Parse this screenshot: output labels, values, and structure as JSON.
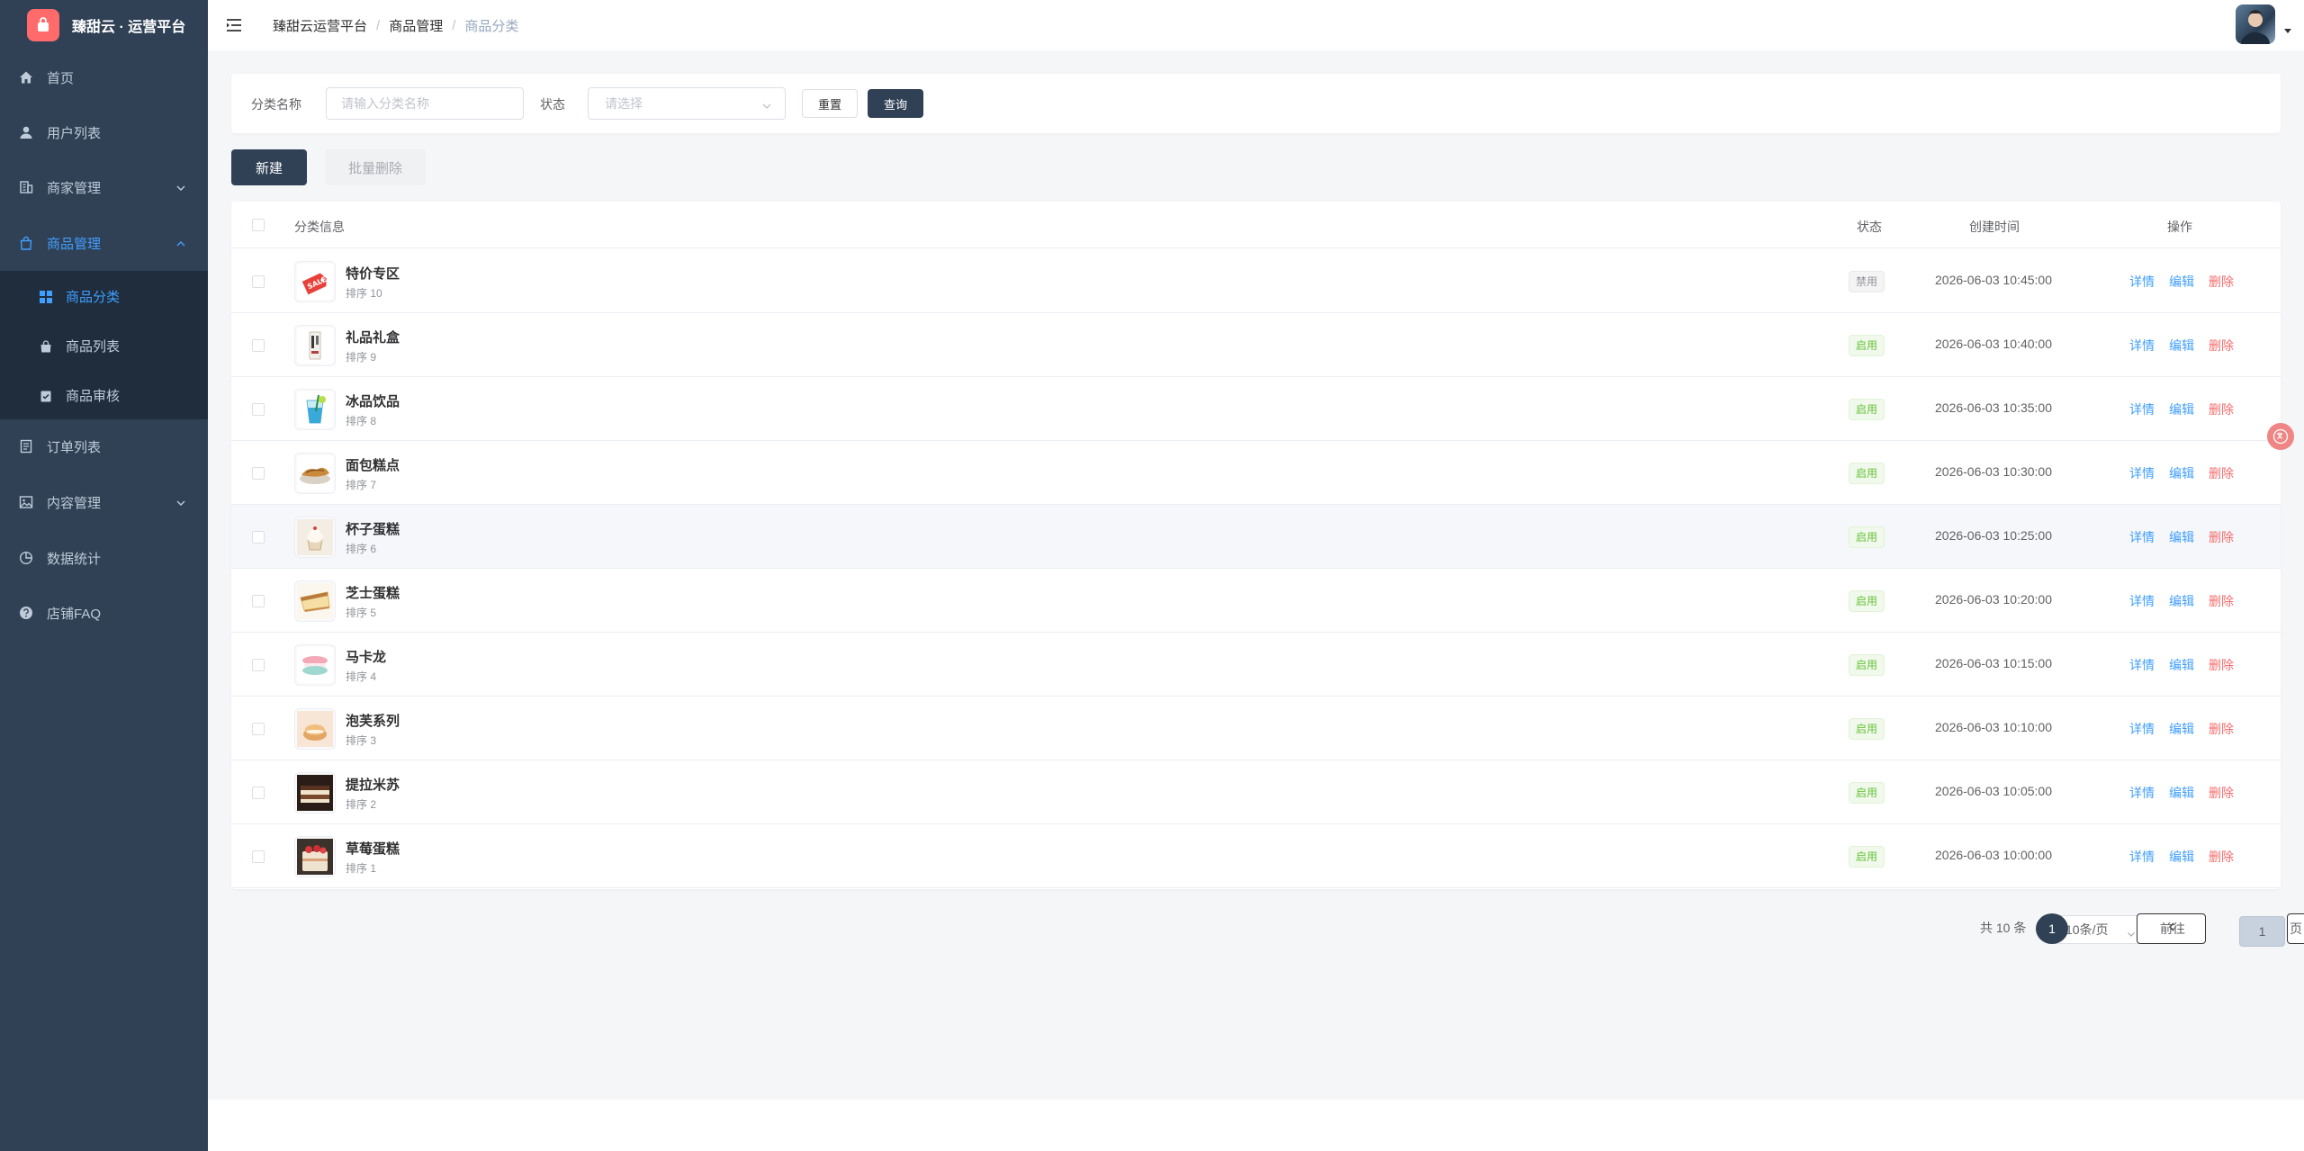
{
  "app": {
    "title": "臻甜云 · 运营平台",
    "brand_color": "#ff6b6b",
    "sidebar_bg": "#304156",
    "accent": "#409eff"
  },
  "sidebar": {
    "items": [
      {
        "label": "首页",
        "icon": "home-icon"
      },
      {
        "label": "用户列表",
        "icon": "user-icon"
      },
      {
        "label": "商家管理",
        "icon": "building-icon"
      },
      {
        "label": "商品管理",
        "icon": "shopping-bag-icon"
      },
      {
        "label": "订单列表",
        "icon": "document-icon"
      },
      {
        "label": "内容管理",
        "icon": "image-icon"
      },
      {
        "label": "数据统计",
        "icon": "pie-chart-icon"
      },
      {
        "label": "店铺FAQ",
        "icon": "help-icon"
      }
    ],
    "subitems": [
      {
        "label": "商品分类",
        "icon": "grid-icon"
      },
      {
        "label": "商品列表",
        "icon": "bag-icon"
      },
      {
        "label": "商品审核",
        "icon": "clipboard-check-icon"
      }
    ]
  },
  "header": {
    "breadcrumb": [
      "臻甜云运营平台",
      "商品管理",
      "商品分类"
    ]
  },
  "search": {
    "name_label": "分类名称",
    "name_placeholder": "请输入分类名称",
    "status_label": "状态",
    "status_placeholder": "请选择",
    "reset_label": "重置",
    "query_label": "查询"
  },
  "toolbar": {
    "new_label": "新建",
    "batch_delete_label": "批量删除"
  },
  "table": {
    "columns": {
      "info": "分类信息",
      "status": "状态",
      "created": "创建时间",
      "actions": "操作"
    },
    "actions": {
      "detail": "详情",
      "edit": "编辑",
      "delete": "删除"
    },
    "rows": [
      {
        "name": "特价专区",
        "sort": "排序 10",
        "status": "禁用",
        "enabled": false,
        "created": "2026-06-03 10:45:00"
      },
      {
        "name": "礼品礼盒",
        "sort": "排序 9",
        "status": "启用",
        "enabled": true,
        "created": "2026-06-03 10:40:00"
      },
      {
        "name": "冰品饮品",
        "sort": "排序 8",
        "status": "启用",
        "enabled": true,
        "created": "2026-06-03 10:35:00"
      },
      {
        "name": "面包糕点",
        "sort": "排序 7",
        "status": "启用",
        "enabled": true,
        "created": "2026-06-03 10:30:00"
      },
      {
        "name": "杯子蛋糕",
        "sort": "排序 6",
        "status": "启用",
        "enabled": true,
        "created": "2026-06-03 10:25:00"
      },
      {
        "name": "芝士蛋糕",
        "sort": "排序 5",
        "status": "启用",
        "enabled": true,
        "created": "2026-06-03 10:20:00"
      },
      {
        "name": "马卡龙",
        "sort": "排序 4",
        "status": "启用",
        "enabled": true,
        "created": "2026-06-03 10:15:00"
      },
      {
        "name": "泡芙系列",
        "sort": "排序 3",
        "status": "启用",
        "enabled": true,
        "created": "2026-06-03 10:10:00"
      },
      {
        "name": "提拉米苏",
        "sort": "排序 2",
        "status": "启用",
        "enabled": true,
        "created": "2026-06-03 10:05:00"
      },
      {
        "name": "草莓蛋糕",
        "sort": "排序 1",
        "status": "启用",
        "enabled": true,
        "created": "2026-06-03 10:00:00"
      }
    ]
  },
  "pagination": {
    "total": "共 10 条",
    "page_size": "10条/页",
    "current": "1",
    "goto_label": "前往",
    "goto_value": "1",
    "page_suffix": "页"
  }
}
